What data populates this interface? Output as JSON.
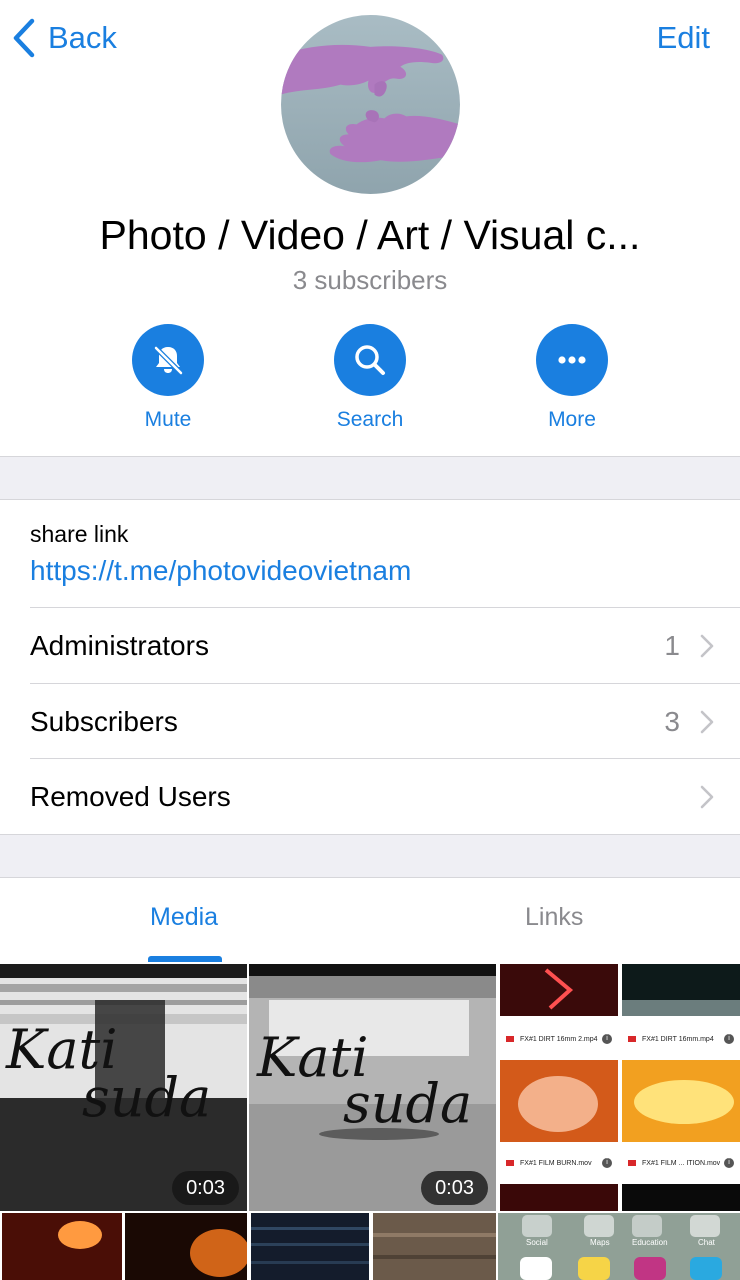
{
  "nav": {
    "back_label": "Back",
    "edit_label": "Edit"
  },
  "channel": {
    "title": "Photo / Video / Art / Visual c...",
    "subscribers_text": "3 subscribers"
  },
  "actions": {
    "mute_label": "Mute",
    "search_label": "Search",
    "more_label": "More"
  },
  "info": {
    "share_caption": "share link",
    "share_url": "https://t.me/photovideovietnam"
  },
  "rows": [
    {
      "label": "Administrators",
      "value": "1"
    },
    {
      "label": "Subscribers",
      "value": "3"
    },
    {
      "label": "Removed Users",
      "value": ""
    }
  ],
  "tabs": {
    "media": "Media",
    "links": "Links",
    "active": "Media"
  },
  "media": {
    "video_1": {
      "duration": "0:03",
      "overlay_text_top": "Kati",
      "overlay_text_bottom": "suda"
    },
    "video_2": {
      "duration": "0:03",
      "overlay_text_top": "Kati",
      "overlay_text_bottom": "suda"
    },
    "files": [
      "FX#1 DIRT 16mm 2.mp4",
      "FX#1 DIRT 16mm.mp4",
      "FX#1 FILM BURN.mov",
      "FX#1 FILM ... ITION.mov"
    ],
    "homescreen_labels": [
      "Social",
      "Maps",
      "Education",
      "Chat"
    ]
  },
  "colors": {
    "accent": "#1a7fe0",
    "secondary_text": "#8a8a8e",
    "separator_band": "#efeff4"
  }
}
